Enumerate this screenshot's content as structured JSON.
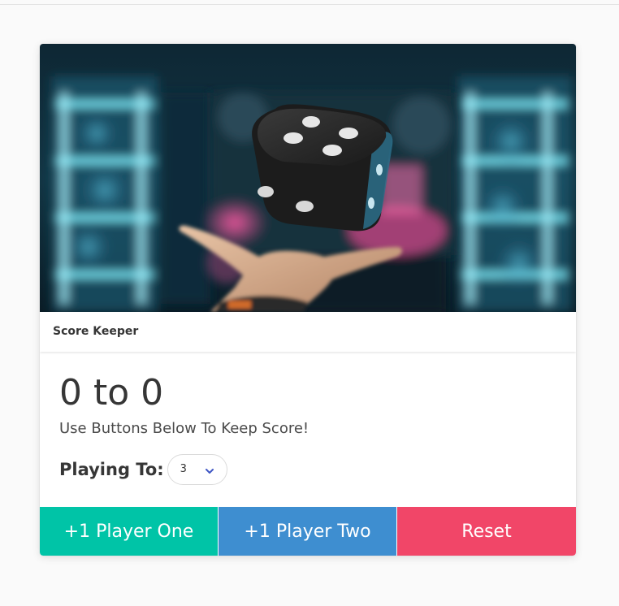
{
  "card": {
    "image_alt": "dice",
    "header_title": "Score Keeper"
  },
  "score": {
    "player_one": "0",
    "separator": "to",
    "player_two": "0",
    "display": "0 to 0",
    "subtitle": "Use Buttons Below To Keep Score!"
  },
  "playing_to": {
    "label": "Playing To:",
    "selected": "3"
  },
  "buttons": {
    "player_one": "+1 Player One",
    "player_two": "+1 Player Two",
    "reset": "Reset"
  },
  "colors": {
    "player_one_button": "#00c4a7",
    "player_two_button": "#3e8ed0",
    "reset_button": "#f14668",
    "select_arrow": "#3e56c4"
  },
  "icons": {
    "select_arrow": "chevron-down-icon"
  }
}
